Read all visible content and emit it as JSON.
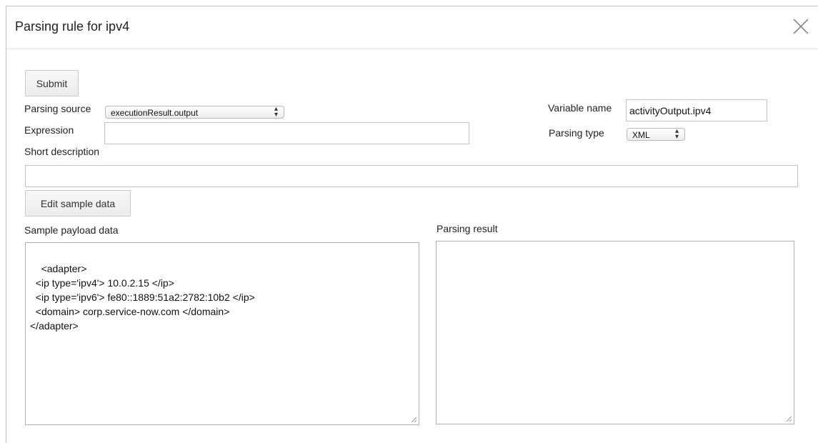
{
  "dialog": {
    "title": "Parsing rule for ipv4"
  },
  "form": {
    "submit_label": "Submit",
    "parsing_source_label": "Parsing source",
    "parsing_source_value": "executionResult.output",
    "expression_label": "Expression",
    "expression_value": "",
    "short_description_label": "Short description",
    "short_description_value": "",
    "variable_name_label": "Variable name",
    "variable_name_value": "activityOutput.ipv4",
    "parsing_type_label": "Parsing type",
    "parsing_type_value": "XML",
    "edit_sample_label": "Edit sample data",
    "sample_payload_label": "Sample payload data",
    "sample_payload_value": "<adapter>\n  <ip type='ipv4'> 10.0.2.15 </ip>\n  <ip type='ipv6'> fe80::1889:51a2:2782:10b2 </ip>\n  <domain> corp.service-now.com </domain>\n</adapter>",
    "parsing_result_label": "Parsing result",
    "parsing_result_value": ""
  },
  "icons": {
    "close": "close-icon",
    "select_arrows": "updown-arrows-icon",
    "resize": "resize-grip-icon"
  },
  "colors": {
    "border": "#c4c4c4",
    "button_bg": "#f0f0f0",
    "text": "#222222"
  }
}
